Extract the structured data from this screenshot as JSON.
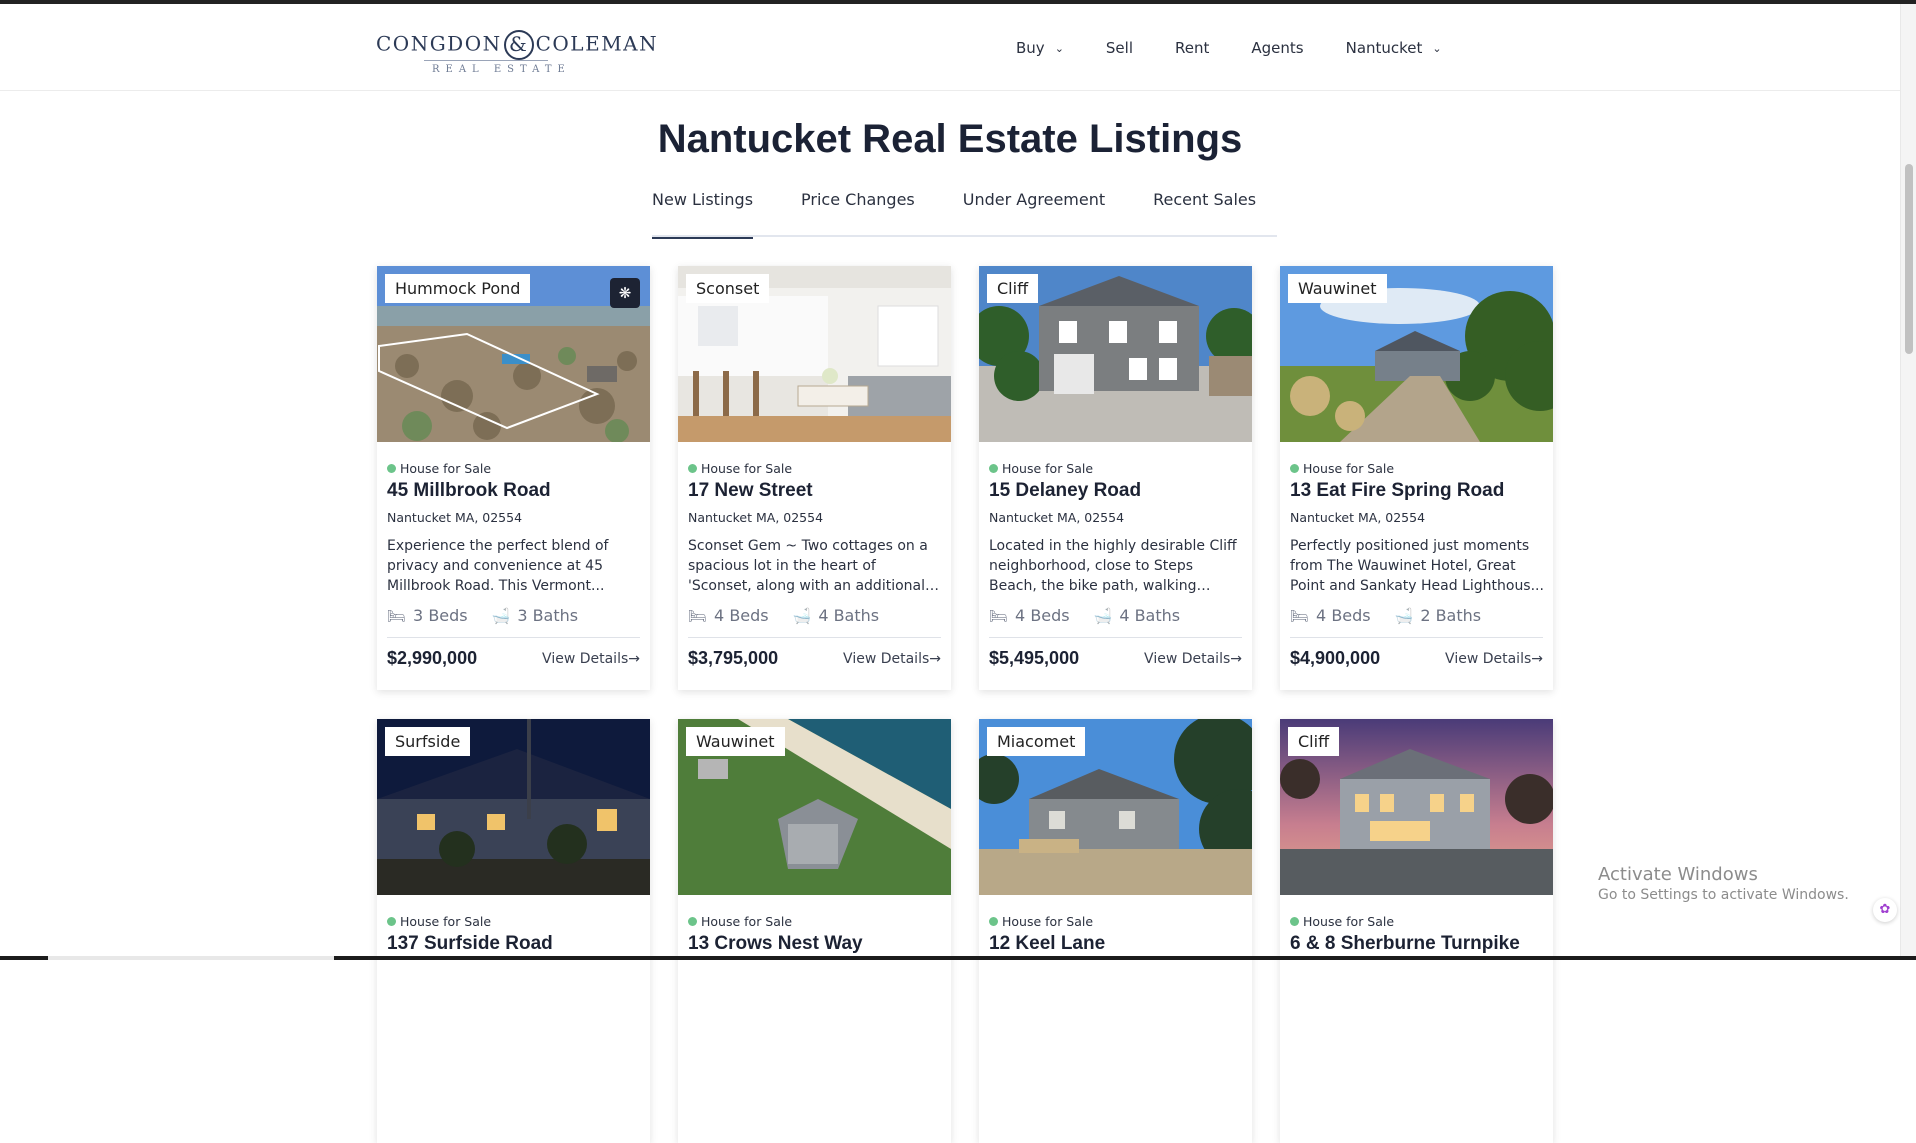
{
  "header": {
    "logo": {
      "main_left": "CONGDON",
      "amp": "&",
      "main_right": "COLEMAN",
      "sub": "REAL ESTATE"
    },
    "nav": [
      {
        "label": "Buy",
        "dropdown": true
      },
      {
        "label": "Sell",
        "dropdown": false
      },
      {
        "label": "Rent",
        "dropdown": false
      },
      {
        "label": "Agents",
        "dropdown": false
      },
      {
        "label": "Nantucket",
        "dropdown": true
      }
    ]
  },
  "main": {
    "title": "Nantucket Real Estate Listings",
    "tabs": [
      {
        "label": "New Listings",
        "active": true
      },
      {
        "label": "Price Changes",
        "active": false
      },
      {
        "label": "Under Agreement",
        "active": false
      },
      {
        "label": "Recent Sales",
        "active": false
      }
    ]
  },
  "listings": [
    {
      "area": "Hummock Pond",
      "has_tour": true,
      "status": "House for Sale",
      "address": "45 Millbrook Road",
      "city": "Nantucket MA, 02554",
      "description": "Experience the perfect blend of privacy and convenience at 45 Millbrook Road. This Vermont...",
      "beds": "3 Beds",
      "baths": "3 Baths",
      "price": "$2,990,000",
      "details": "View Details",
      "photo": "aerial-lot"
    },
    {
      "area": "Sconset",
      "has_tour": false,
      "status": "House for Sale",
      "address": "17 New Street",
      "city": "Nantucket MA, 02554",
      "description": "Sconset Gem ~ Two cottages on a spacious lot in the heart of 'Sconset, along with an additional doll hous...",
      "beds": "4 Beds",
      "baths": "4 Baths",
      "price": "$3,795,000",
      "details": "View Details",
      "photo": "kitchen-interior"
    },
    {
      "area": "Cliff",
      "has_tour": false,
      "status": "House for Sale",
      "address": "15 Delaney Road",
      "city": "Nantucket MA, 02554",
      "description": "Located in the highly desirable Cliff neighborhood, close to Steps Beach, the bike path, walking path...",
      "beds": "4 Beds",
      "baths": "4 Baths",
      "price": "$5,495,000",
      "details": "View Details",
      "photo": "shingle-house"
    },
    {
      "area": "Wauwinet",
      "has_tour": false,
      "status": "House for Sale",
      "address": "13 Eat Fire Spring Road",
      "city": "Nantucket MA, 02554",
      "description": "Perfectly positioned just moments from The Wauwinet Hotel, Great Point and Sankaty Head Lighthous...",
      "beds": "4 Beds",
      "baths": "2 Baths",
      "price": "$4,900,000",
      "details": "View Details",
      "photo": "driveway-house"
    },
    {
      "area": "Surfside",
      "has_tour": false,
      "status": "House for Sale",
      "address": "137 Surfside Road",
      "photo": "night-house"
    },
    {
      "area": "Wauwinet",
      "has_tour": false,
      "status": "House for Sale",
      "address": "13 Crows Nest Way",
      "photo": "beach-aerial"
    },
    {
      "area": "Miacomet",
      "has_tour": false,
      "status": "House for Sale",
      "address": "12 Keel Lane",
      "photo": "trees-house"
    },
    {
      "area": "Cliff",
      "has_tour": false,
      "status": "House for Sale",
      "address": "6 & 8 Sherburne Turnpike",
      "photo": "dusk-house"
    }
  ],
  "os_overlay": {
    "line1": "Activate Windows",
    "line2": "Go to Settings to activate Windows."
  },
  "colors": {
    "brand_navy": "#2c3a56",
    "status_green": "#6cc48a",
    "text_dark": "#1c2233"
  }
}
